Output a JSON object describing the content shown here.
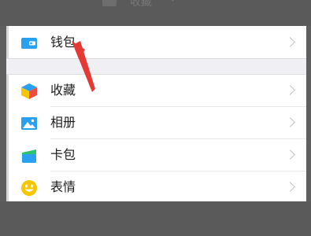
{
  "top_hint": {
    "label": "收藏"
  },
  "menu": {
    "group1": [
      {
        "label": "钱包",
        "icon": "wallet-icon"
      }
    ],
    "group2": [
      {
        "label": "收藏",
        "icon": "favorites-cube-icon"
      },
      {
        "label": "相册",
        "icon": "album-icon"
      },
      {
        "label": "卡包",
        "icon": "card-pack-icon"
      },
      {
        "label": "表情",
        "icon": "smiley-icon"
      }
    ]
  },
  "colors": {
    "accent_blue": "#2aa0f0",
    "annotation_red": "#e53935",
    "smiley_yellow": "#f7c600"
  }
}
